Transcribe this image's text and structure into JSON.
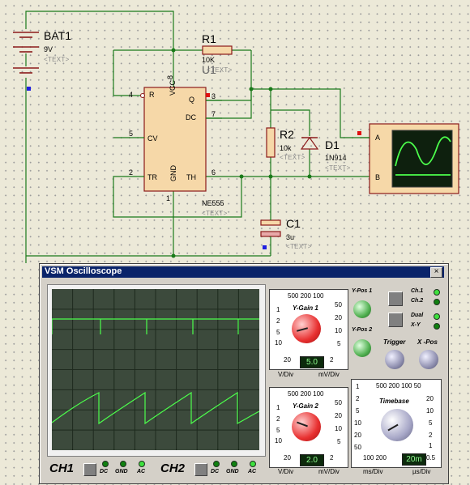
{
  "schematic": {
    "bat1": {
      "name": "BAT1",
      "value": "9V",
      "text": "<TEXT>"
    },
    "r1": {
      "name": "R1",
      "value": "10K",
      "text": "<TEXT>"
    },
    "u1": {
      "name": "U1",
      "text": "<TEXT>",
      "part": "NE555",
      "pins": {
        "r": "R",
        "vcc": "VCC",
        "q": "Q",
        "dc": "DC",
        "cv": "CV",
        "tr": "TR",
        "gnd": "GND",
        "th": "TH"
      },
      "pin_numbers": {
        "n4": "4",
        "n8": "8",
        "n3": "3",
        "n7": "7",
        "n5": "5",
        "n2": "2",
        "n1": "1",
        "n6": "6"
      }
    },
    "r2": {
      "name": "R2",
      "value": "10k",
      "text": "<TEXT>"
    },
    "d1": {
      "name": "D1",
      "value": "1N914",
      "text": "<TEXT>"
    },
    "c1": {
      "name": "C1",
      "value": "3u",
      "text": "<TEXT>"
    },
    "scope_inputs": {
      "a": "A",
      "b": "B"
    }
  },
  "scope": {
    "title": "VSM Oscilloscope",
    "close": "×",
    "ch1_label": "CH1",
    "ch2_label": "CH2",
    "coupling": [
      "DC",
      "GND",
      "AC"
    ],
    "ch1_coupling_active": "AC",
    "ch2_coupling_active": "AC",
    "channel_section": {
      "ygain1_title": "Y-Gain 1",
      "ygain2_title": "Y-Gain 2",
      "top_scale": "500 200 100",
      "left_scale": [
        "1",
        "2",
        "5",
        "10",
        "20"
      ],
      "right_scale": [
        "50",
        "20",
        "10",
        "5",
        "2"
      ],
      "vdiv": "V/Div",
      "mvdiv": "mV/Div",
      "ygain1_value": "5.0",
      "ygain2_value": "2.0",
      "ypos1": "Y-Pos 1",
      "ypos2": "Y-Pos 2"
    },
    "mode": {
      "ch1": "Ch.1",
      "ch2": "Ch.2",
      "dual": "Dual",
      "xy": "X-Y"
    },
    "trigger": "Trigger",
    "xpos": "X -Pos",
    "timebase": {
      "title": "Timebase",
      "top_scale": "500 200 100 50",
      "left_scale": [
        "1",
        "2",
        "5",
        "10",
        "20",
        "50"
      ],
      "right_scale": [
        "20",
        "10",
        "5",
        "2",
        "1",
        "0.5"
      ],
      "bottom_scale": "100 200",
      "msdiv": "ms/Div",
      "usdiv": "µs/Div",
      "value": "20m"
    },
    "colors": {
      "trace": "#4cff4c",
      "screen": "#3c4a3c",
      "grid": "#1e2a1e"
    }
  }
}
